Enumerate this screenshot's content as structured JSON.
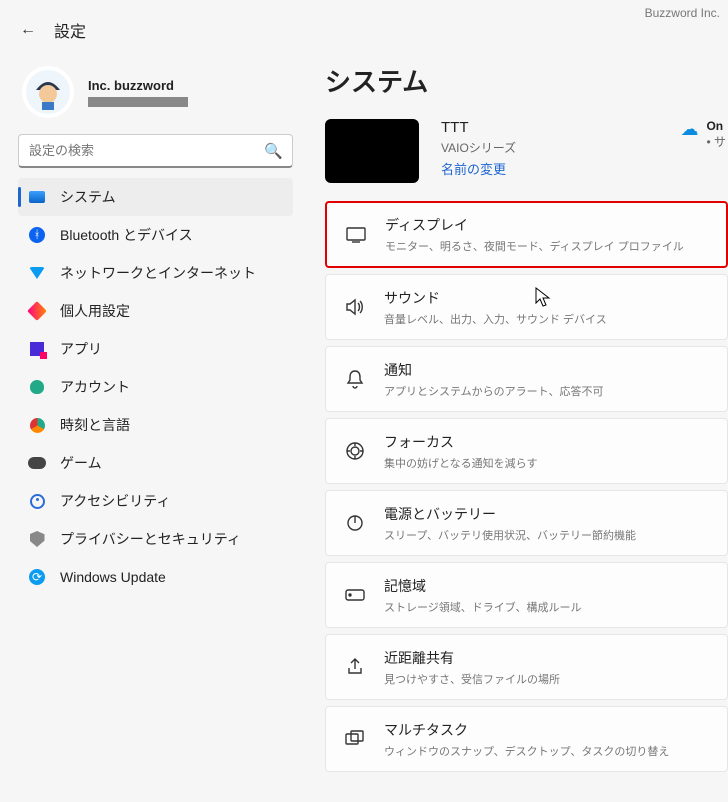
{
  "brand": "Buzzword Inc.",
  "header": {
    "back": "←",
    "title": "設定"
  },
  "profile": {
    "name": "Inc. buzzword"
  },
  "search": {
    "placeholder": "設定の検索"
  },
  "sidebar": {
    "items": [
      {
        "label": "システム"
      },
      {
        "label": "Bluetooth とデバイス"
      },
      {
        "label": "ネットワークとインターネット"
      },
      {
        "label": "個人用設定"
      },
      {
        "label": "アプリ"
      },
      {
        "label": "アカウント"
      },
      {
        "label": "時刻と言語"
      },
      {
        "label": "ゲーム"
      },
      {
        "label": "アクセシビリティ"
      },
      {
        "label": "プライバシーとセキュリティ"
      },
      {
        "label": "Windows Update"
      }
    ]
  },
  "main": {
    "title": "システム",
    "device": {
      "name": "TTT",
      "series": "VAIOシリーズ",
      "rename": "名前の変更"
    },
    "cloud": {
      "title": "On",
      "sub": "• サ"
    },
    "cards": [
      {
        "title": "ディスプレイ",
        "sub": "モニター、明るさ、夜間モード、ディスプレイ プロファイル"
      },
      {
        "title": "サウンド",
        "sub": "音量レベル、出力、入力、サウンド デバイス"
      },
      {
        "title": "通知",
        "sub": "アプリとシステムからのアラート、応答不可"
      },
      {
        "title": "フォーカス",
        "sub": "集中の妨げとなる通知を減らす"
      },
      {
        "title": "電源とバッテリー",
        "sub": "スリープ、バッテリ使用状況、バッテリー節約機能"
      },
      {
        "title": "記憶域",
        "sub": "ストレージ領域、ドライブ、構成ルール"
      },
      {
        "title": "近距離共有",
        "sub": "見つけやすさ、受信ファイルの場所"
      },
      {
        "title": "マルチタスク",
        "sub": "ウィンドウのスナップ、デスクトップ、タスクの切り替え"
      }
    ]
  }
}
